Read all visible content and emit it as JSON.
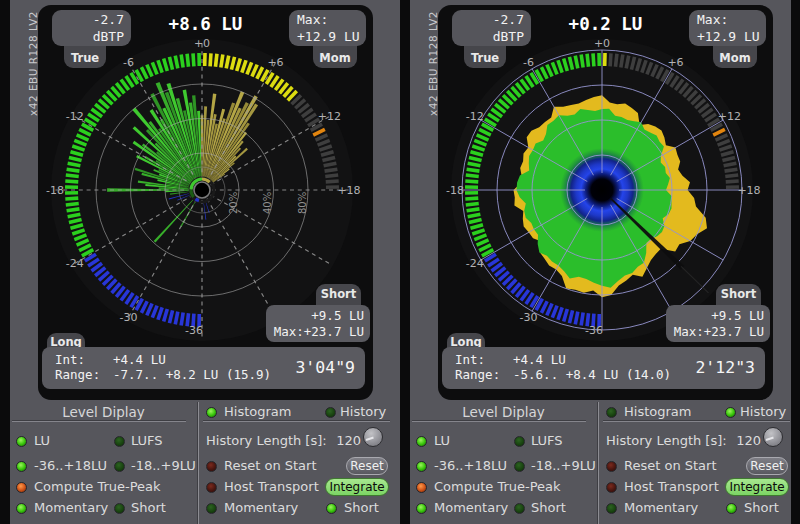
{
  "window": {
    "side_label": "x42 EBU R128 LV2",
    "bg": "#56565C",
    "edge": "#0B0B0C"
  },
  "palette": {
    "ring_green": "#2BD01E",
    "ring_yellow": "#DCDC10",
    "ring_blue": "#2836D8",
    "ring_dim": "#3E3E3E",
    "ring_peak_orange": "#E2850F",
    "bar_green": [
      "#2E9424",
      "#3FC92F",
      "#37AE2A"
    ],
    "bar_yellow": [
      "#968A37",
      "#B4A645",
      "#A49740"
    ],
    "bar_blue": "#2334CC",
    "grid_gray": "#9A9A9A",
    "grid_lavender": "#9595CF",
    "tick_label": "#B2B2B5",
    "panel": "#0D0D0E",
    "circle_bg": "#121213",
    "badge": "#55555B",
    "tab": "#46464B",
    "box": "#5A5A60",
    "radar_green": "#2BBE2B",
    "radar_yellow": "#E3BA1E"
  },
  "scale": {
    "min": -36,
    "max": 18,
    "deg_per_lu": 5,
    "seg_step": 0.5,
    "labels": [
      {
        "v": -36,
        "t": "-36"
      },
      {
        "v": -30,
        "t": "-30"
      },
      {
        "v": -24,
        "t": "-24"
      },
      {
        "v": -18,
        "t": "-18"
      },
      {
        "v": -12,
        "t": "-12"
      },
      {
        "v": -6,
        "t": "-6"
      },
      {
        "v": 0,
        "t": "+0"
      },
      {
        "v": 6,
        "t": "+6"
      },
      {
        "v": 12,
        "t": "+12"
      },
      {
        "v": 18,
        "t": "+18"
      }
    ]
  },
  "plugins": [
    {
      "header": {
        "value": "+8.6 LU",
        "dbtp_line1": "-2.7",
        "dbtp_line2": "dBTP",
        "true_tab": "True",
        "max_line1": "Max:",
        "max_line2": "+12.9 LU",
        "mom_tab": "Mom"
      },
      "short_box": {
        "tab": "Short",
        "line1": "+9.5 LU",
        "line2": "Max:+23.7 LU"
      },
      "long_box": {
        "tab": "Long",
        "int_label": "Int:",
        "int_value": "+4.4 LU",
        "range_label": "Range:",
        "range_value": "-7.7.. +8.2 LU (15.9)",
        "time": "3'04\"9"
      },
      "meter": {
        "mode": "histogram",
        "current_lu": 8.6,
        "peak_hold_lu": 12.5,
        "percent_labels": [
          "20%",
          "40%",
          "80%"
        ],
        "percent_radii": [
          37,
          71.5,
          106
        ],
        "inner_circle_r": 23,
        "bars": [
          [
            -19.5,
            0.18
          ],
          [
            -18.5,
            0.22
          ],
          [
            -18,
            0.74
          ],
          [
            -17.5,
            0.28
          ],
          [
            -17,
            0.4
          ],
          [
            -16.5,
            0.47
          ],
          [
            -16,
            0.22
          ],
          [
            -15.5,
            0.3
          ],
          [
            -15,
            0.45
          ],
          [
            -14.5,
            0.52
          ],
          [
            -14,
            0.3
          ],
          [
            -13.5,
            0.36
          ],
          [
            -13,
            0.32
          ],
          [
            -12.5,
            0.55
          ],
          [
            -12,
            0.48
          ],
          [
            -11.5,
            0.38
          ],
          [
            -11,
            0.64
          ],
          [
            -10.5,
            0.56
          ],
          [
            -10,
            0.42
          ],
          [
            -9.5,
            0.72
          ],
          [
            -9,
            0.48
          ],
          [
            -8.5,
            0.62
          ],
          [
            -8,
            0.84
          ],
          [
            -7.5,
            0.66
          ],
          [
            -7,
            0.56
          ],
          [
            -6.5,
            0.74
          ],
          [
            -6,
            0.62
          ],
          [
            -5.5,
            0.86
          ],
          [
            -5,
            0.7
          ],
          [
            -4.5,
            0.93
          ],
          [
            -4,
            0.82
          ],
          [
            -3.5,
            0.89
          ],
          [
            -3,
            0.74
          ],
          [
            -2.5,
            0.62
          ],
          [
            -2,
            0.8
          ],
          [
            -1.5,
            0.68
          ],
          [
            -1,
            0.74
          ],
          [
            -0.5,
            0.6
          ],
          [
            -27.5,
            0.52
          ],
          [
            -30,
            0.27
          ],
          [
            0,
            0.56
          ],
          [
            0.5,
            0.64
          ],
          [
            1,
            0.52
          ],
          [
            1.5,
            0.76
          ],
          [
            2,
            0.58
          ],
          [
            2.5,
            0.5
          ],
          [
            3,
            0.64
          ],
          [
            3.5,
            0.56
          ],
          [
            4,
            0.72
          ],
          [
            4.5,
            0.84
          ],
          [
            5,
            0.7
          ],
          [
            5.5,
            0.77
          ],
          [
            6,
            0.86
          ],
          [
            6.5,
            0.8
          ],
          [
            7,
            0.62
          ],
          [
            7.5,
            0.54
          ],
          [
            8,
            0.46
          ],
          [
            8.5,
            0.4
          ],
          [
            9,
            0.32
          ],
          [
            9.5,
            0.44
          ],
          [
            10,
            0.27
          ],
          [
            10.5,
            0.2
          ],
          [
            11,
            0.14
          ]
        ],
        "bars_blue": [
          [
            -21,
            0.2
          ],
          [
            -22.5,
            0.13
          ],
          [
            -37.5,
            0.16
          ],
          [
            -39.5,
            0.11
          ]
        ]
      },
      "controls": {
        "title": "Level Diplay",
        "unit_options": [
          {
            "label": "LU",
            "on": true
          },
          {
            "label": "LUFS",
            "on": false
          }
        ],
        "range_options": [
          {
            "label": "-36..+18LU",
            "on": true
          },
          {
            "label": "-18..+9LU",
            "on": false
          }
        ],
        "true_peak": {
          "label": "Compute True-Peak",
          "on": true
        },
        "ring_options": [
          {
            "label": "Momentary",
            "on": true
          },
          {
            "label": "Short",
            "on": false
          }
        ],
        "history_length": {
          "label": "History Length [s]:",
          "value": "120"
        },
        "reset_row": {
          "label": "Reset on Start",
          "on": false,
          "button": "Reset"
        },
        "transport_row": {
          "label": "Host Transport",
          "on": false,
          "button": "Integrate"
        },
        "st_options": [
          {
            "label": "Momentary",
            "on": false
          },
          {
            "label": "Short",
            "on": true
          }
        ],
        "mode_options": [
          {
            "label": "Histogram",
            "on": true
          },
          {
            "label": "History",
            "on": false
          }
        ]
      }
    },
    {
      "header": {
        "value": "+0.2 LU",
        "dbtp_line1": "-2.7",
        "dbtp_line2": "dBTP",
        "true_tab": "True",
        "max_line1": "Max:",
        "max_line2": "+12.9 LU",
        "mom_tab": "Mom"
      },
      "short_box": {
        "tab": "Short",
        "line1": "+9.5 LU",
        "line2": "Max:+23.7 LU"
      },
      "long_box": {
        "tab": "Long",
        "int_label": "Int:",
        "int_value": "+4.4 LU",
        "range_label": "Range:",
        "range_value": "-5.6.. +8.4 LU (14.0)",
        "time": "2'12\"3"
      },
      "meter": {
        "mode": "history",
        "current_lu": 0.2,
        "peak_hold_lu": 12.5,
        "needle_deg": 134,
        "radar_green_r": [
          81.0,
          81.5,
          75.3,
          75.5,
          74.4,
          75.9,
          78.3,
          74.0,
          74.9,
          77.2,
          75.2,
          75.6,
          68.0,
          64.8,
          67.2,
          66.1,
          68.9,
          66.4,
          64.0,
          69.8,
          70.6,
          72.0,
          70.8,
          67.0,
          72.1,
          73.2,
          72.1,
          69.1,
          69.0,
          77.0,
          83.9,
          84.6,
          88.2,
          88.4,
          92.4,
          98.2,
          95.8,
          93.1,
          90.4,
          89.8,
          94.1,
          89.7,
          87.1,
          87.2,
          85.7,
          88.6,
          83.9,
          78.1,
          78.6,
          78.0,
          81.2,
          80.5,
          77.4,
          82.6,
          85.5,
          85.2,
          83.4,
          75.4,
          77.9,
          80.4,
          79.8,
          81.0,
          76.8,
          79.2,
          85.0,
          84.6,
          86.4,
          81.9,
          80.2,
          83.9,
          81.2,
          79.4
        ],
        "radar_yellow_r": [
          94.8,
          87.8,
          87.0,
          89.7,
          87.2,
          84.9,
          75.2,
          80.6,
          82.9,
          84.2,
          81.5,
          78.0,
          84.7,
          83.2,
          83.2,
          78.8,
          81.7,
          88.3,
          85.6,
          92.5,
          95.5,
          107.4,
          111.7,
          104.9,
          102.0,
          94.5,
          95.5,
          83.1,
          83.7,
          85.5,
          89.9,
          95.7,
          90.1,
          93.8,
          96.9,
          105.3,
          107.2,
          100.9,
          104.4,
          103.2,
          104.7,
          94.9,
          91.7,
          92.3,
          89.6,
          87.9,
          79.7,
          84.2,
          84.6,
          86.4,
          84.3,
          81.5,
          89.0,
          87.5,
          88.5,
          81.3,
          81.6,
          84.7,
          84.0,
          86.6,
          85.1,
          91.9,
          92.1,
          88.8,
          88.6,
          88.5,
          96.2,
          91.8,
          90.4,
          89.7,
          91.3,
          93.3
        ],
        "grid_circles_r": [
          35,
          70,
          105,
          140
        ]
      },
      "controls": {
        "title": "Level Diplay",
        "unit_options": [
          {
            "label": "LU",
            "on": true
          },
          {
            "label": "LUFS",
            "on": false
          }
        ],
        "range_options": [
          {
            "label": "-36..+18LU",
            "on": true
          },
          {
            "label": "-18..+9LU",
            "on": false
          }
        ],
        "true_peak": {
          "label": "Compute True-Peak",
          "on": true
        },
        "ring_options": [
          {
            "label": "Momentary",
            "on": true
          },
          {
            "label": "Short",
            "on": false
          }
        ],
        "history_length": {
          "label": "History Length [s]:",
          "value": "120"
        },
        "reset_row": {
          "label": "Reset on Start",
          "on": false,
          "button": "Reset"
        },
        "transport_row": {
          "label": "Host Transport",
          "on": false,
          "button": "Integrate"
        },
        "st_options": [
          {
            "label": "Momentary",
            "on": false
          },
          {
            "label": "Short",
            "on": true
          }
        ],
        "mode_options": [
          {
            "label": "Histogram",
            "on": false
          },
          {
            "label": "History",
            "on": true
          }
        ]
      }
    }
  ]
}
